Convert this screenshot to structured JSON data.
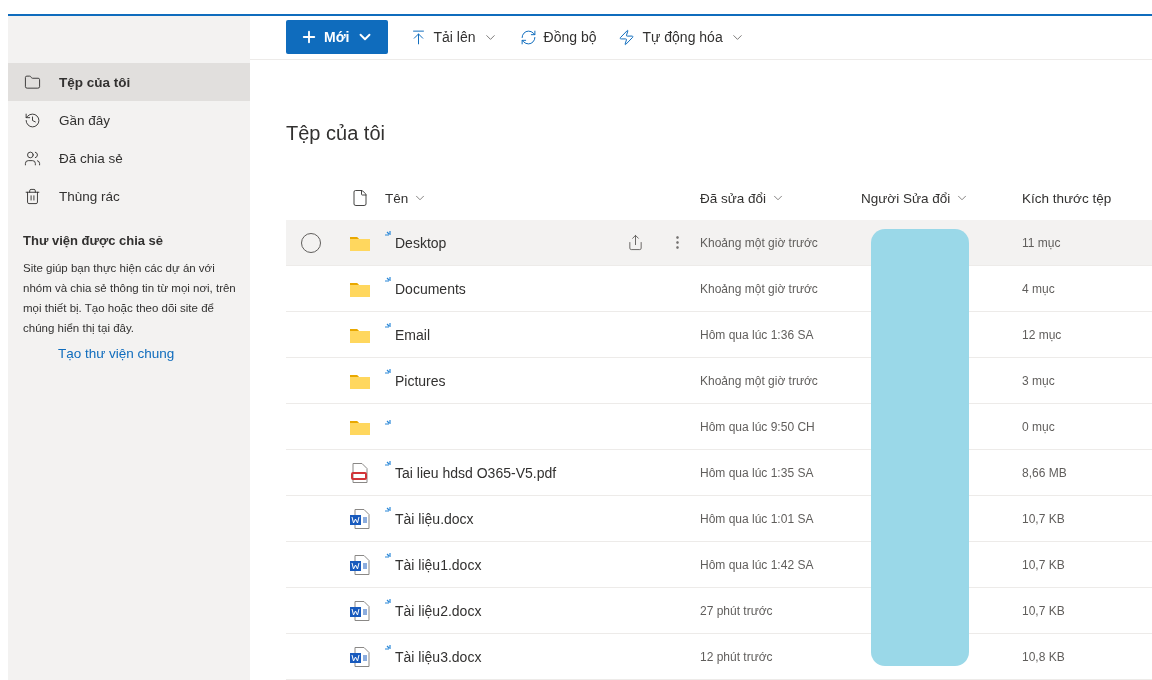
{
  "sidebar": {
    "items": [
      {
        "label": "Tệp của tôi",
        "selected": true
      },
      {
        "label": "Gần đây",
        "selected": false
      },
      {
        "label": "Đã chia sẻ",
        "selected": false
      },
      {
        "label": "Thùng rác",
        "selected": false
      }
    ],
    "shared_libraries": {
      "heading": "Thư viện được chia sẻ",
      "description": "Site giúp bạn thực hiện các dự án với nhóm và chia sẻ thông tin từ mọi nơi, trên mọi thiết bị. Tạo hoặc theo dõi site để chúng hiển thị tại đây.",
      "link": "Tạo thư viện chung"
    }
  },
  "toolbar": {
    "new_button": "Mới",
    "actions": [
      {
        "label": "Tải lên",
        "dropdown": true
      },
      {
        "label": "Đồng bộ",
        "dropdown": false
      },
      {
        "label": "Tự động hóa",
        "dropdown": true
      }
    ]
  },
  "page_title": "Tệp của tôi",
  "table": {
    "columns": [
      "Tên",
      "Đã sửa đổi",
      "Người Sửa đổi",
      "Kích thước tệp"
    ],
    "rows": [
      {
        "kind": "folder",
        "name": "Desktop",
        "modified": "Khoảng một giờ trước",
        "size": "11 mục",
        "hovered": true
      },
      {
        "kind": "folder",
        "name": "Documents",
        "modified": "Khoảng một giờ trước",
        "size": "4 mục",
        "hovered": false
      },
      {
        "kind": "folder",
        "name": "Email",
        "modified": "Hôm qua lúc 1:36 SA",
        "size": "12 mục",
        "hovered": false
      },
      {
        "kind": "folder",
        "name": "Pictures",
        "modified": "Khoảng một giờ trước",
        "size": "3 mục",
        "hovered": false
      },
      {
        "kind": "folder",
        "modified": "Hôm qua lúc 9:50 CH",
        "size": "0 mục",
        "hovered": false
      },
      {
        "kind": "pdf",
        "name": "Tai lieu hdsd O365-V5.pdf",
        "modified": "Hôm qua lúc 1:35 SA",
        "size": "8,66 MB",
        "hovered": false
      },
      {
        "kind": "word",
        "name": "Tài liệu.docx",
        "modified": "Hôm qua lúc 1:01 SA",
        "size": "10,7 KB",
        "hovered": false
      },
      {
        "kind": "word",
        "name": "Tài liệu1.docx",
        "modified": "Hôm qua lúc 1:42 SA",
        "size": "10,7 KB",
        "hovered": false
      },
      {
        "kind": "word",
        "name": "Tài liệu2.docx",
        "modified": "27 phút trước",
        "size": "10,7 KB",
        "hovered": false
      },
      {
        "kind": "word",
        "name": "Tài liệu3.docx",
        "modified": "12 phút trước",
        "size": "10,8 KB",
        "hovered": false
      }
    ]
  }
}
